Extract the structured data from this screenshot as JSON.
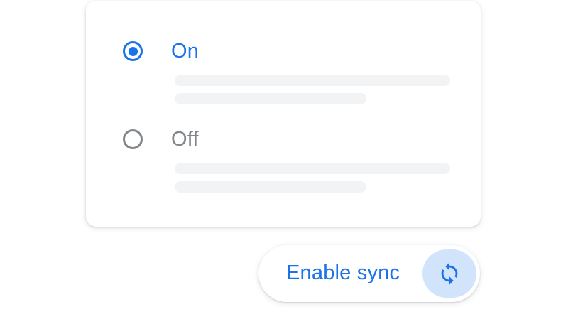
{
  "settings_card": {
    "options": [
      {
        "label": "On",
        "selected": true
      },
      {
        "label": "Off",
        "selected": false
      }
    ]
  },
  "sync_button": {
    "label": "Enable sync",
    "icon": "sync-icon"
  },
  "colors": {
    "accent": "#1a73e8",
    "inactive": "#80868b",
    "skeleton": "#f1f3f4",
    "icon_background": "#d2e3fc"
  }
}
